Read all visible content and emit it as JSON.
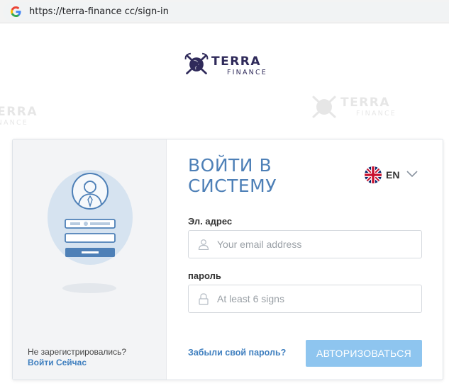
{
  "browser": {
    "url": "https://terra-finance cc/sign-in",
    "favicon_icon": "google-g-icon"
  },
  "logo": {
    "line1": "TERRA",
    "line2": "FINANCE",
    "icon": "globe-shield-icon",
    "color": "#2f2a5a"
  },
  "left_panel": {
    "illustration_icon": "user-login-illustration",
    "signup_question": "Не зарегистрировались?",
    "signup_link": "Войти Сейчас"
  },
  "form": {
    "title": "ВОЙТИ В СИСТЕМУ",
    "language": {
      "code": "EN",
      "flag_icon": "uk-flag-icon"
    },
    "email": {
      "label": "Эл. адрес",
      "placeholder": "Your email address",
      "icon": "user-icon"
    },
    "password": {
      "label": "пароль",
      "placeholder": "At least 6 signs",
      "icon": "lock-icon"
    },
    "forgot_link": "Забыли свой пароль?",
    "submit_label": "АВТОРИЗОВАТЬСЯ"
  },
  "colors": {
    "accent": "#4e80b7",
    "link": "#3f7fbf",
    "button": "#8ec5ef"
  }
}
